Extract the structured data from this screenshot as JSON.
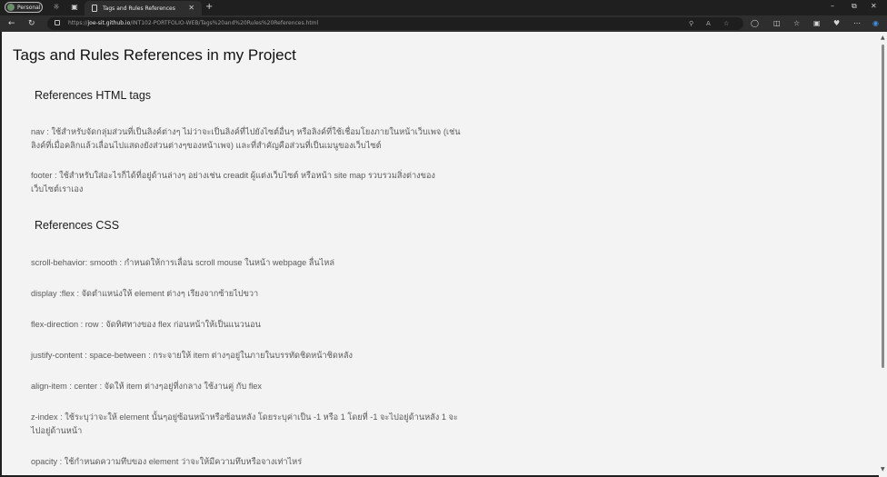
{
  "browser": {
    "profile_label": "Personal",
    "tab_title": "Tags and Rules References",
    "url_prefix": "https://",
    "url_host": "joe-sit.github.io",
    "url_path": "/INT102-PORTFOLIO-WEB/Tags%20and%20Rules%20References.html"
  },
  "page": {
    "title": "Tags and Rules References in my Project",
    "html_heading": "References HTML tags",
    "html_items": [
      "nav : ใช้สำหรับจัดกลุ่มส่วนที่เป็นลิงค์ต่างๆ ไม่ว่าจะเป็นลิงค์ที่ไปยังไซต์อื่นๆ หรือลิงค์ที่ใช้เชื่อมโยงภายในหน้าเว็บเพจ (เช่นลิงค์ที่เมื่อคลิกแล้วเลื่อนไปแสดงยังส่วนต่างๆของหน้าเพจ) และที่สำคัญคือส่วนที่เป็นเมนูของเว็บไซต์",
      "footer : ใช้สำหรับใส่อะไรก็ได้ที่อยู่ด้านล่างๆ อย่างเช่น creadit ผู้แต่งเว็บไซต์ หรือหน้า site map รวบรวมสิ่งต่างของเว็บไซต์เราเอง"
    ],
    "css_heading": "References CSS",
    "css_items": [
      "scroll-behavior: smooth : กำหนดให้การเลื่อน scroll mouse ในหน้า webpage ลื่นไหล่",
      "display :flex : จัดตำแหน่งให้ element ต่างๆ เรียงจากซ้ายไปขวา",
      "flex-direction : row : จัดทิศทางของ flex ก่อนหน้าให้เป็นแนวนอน",
      "justify-content : space-between : กระจายให้ item ต่างๆอยู่ในภายในบรรทัดชิดหน้าชิดหลัง",
      "align-item : center : จัดให้ item ต่างๆอยู่ที่งกลาง ใช้งานคู่ กับ flex",
      "z-index : ใช้ระบุว่าจะให้ element นั้นๆอยู่ซ้อนหน้าหรือซ้อนหลัง โดยระบุค่าเป็น -1 หรือ 1 โดยที่ -1 จะไปอยู่ด้านหลัง 1 จะไปอยู่ด้านหน้า",
      "opacity : ใช้กำหนดความทึบของ element ว่าจะให้มีความทึบหรือจางเท่าไหร่"
    ]
  }
}
